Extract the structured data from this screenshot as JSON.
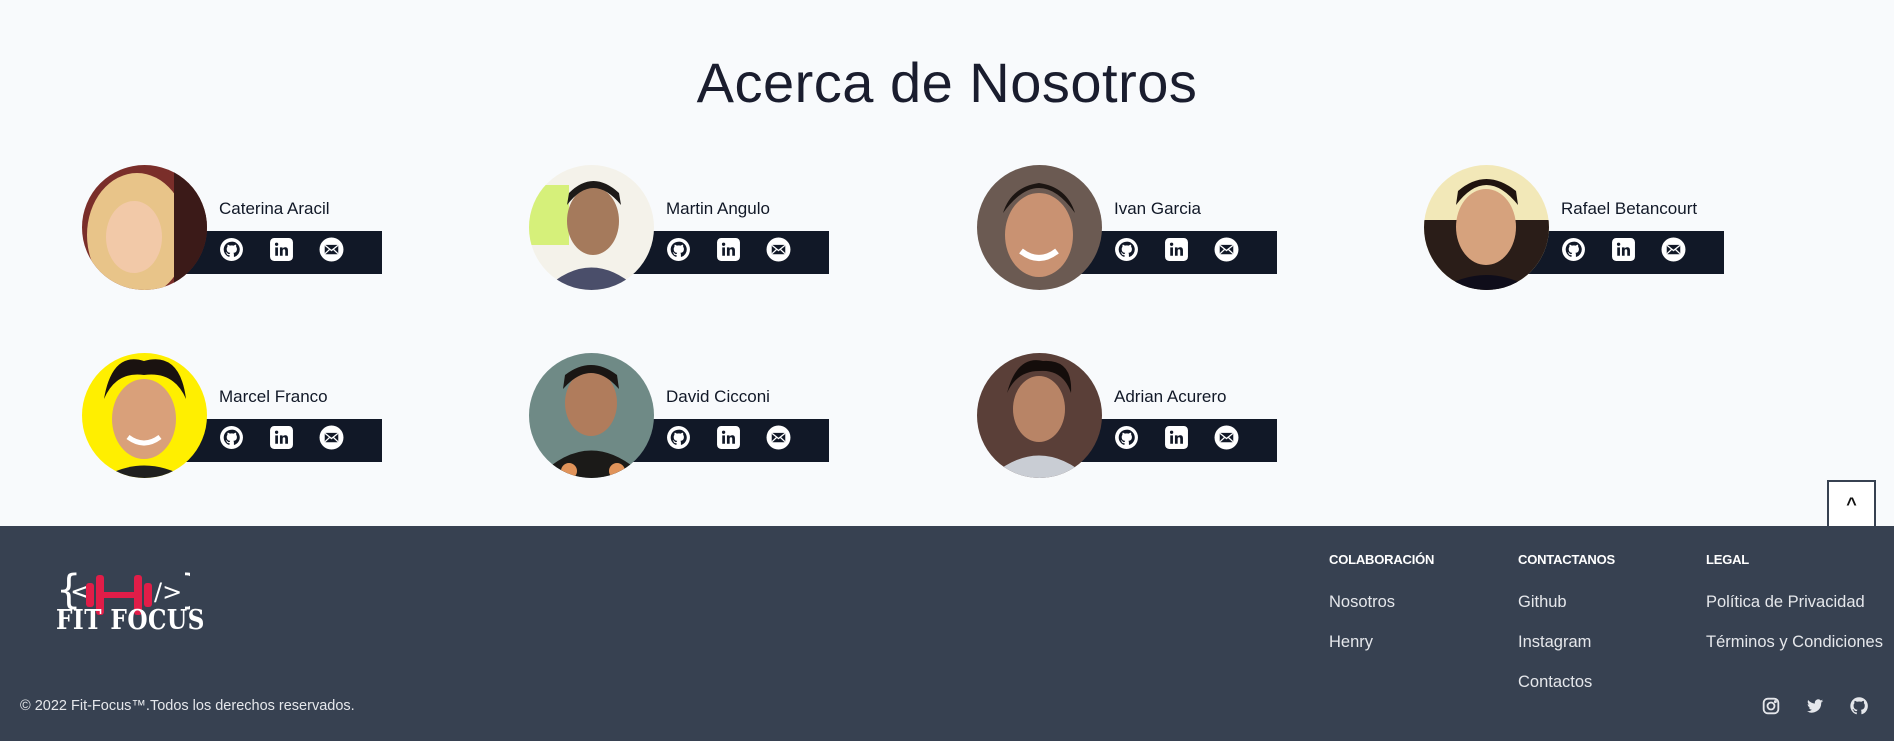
{
  "about": {
    "title": "Acerca de Nosotros",
    "members": [
      {
        "name": "Caterina Aracil"
      },
      {
        "name": "Martin Angulo"
      },
      {
        "name": "Ivan Garcia"
      },
      {
        "name": "Rafael Betancourt"
      },
      {
        "name": "Marcel Franco"
      },
      {
        "name": "David Cicconi"
      },
      {
        "name": "Adrian Acurero"
      }
    ],
    "member_icons": [
      "github-icon",
      "linkedin-icon",
      "mail-icon"
    ]
  },
  "scroll_top": {
    "label": "^"
  },
  "footer": {
    "logo_text": "FIT FOCUS",
    "columns": [
      {
        "heading": "COLABORACIÓN",
        "links": [
          "Nosotros",
          "Henry"
        ]
      },
      {
        "heading": "CONTACTANOS",
        "links": [
          "Github",
          "Instagram",
          "Contactos"
        ]
      },
      {
        "heading": "LEGAL",
        "links": [
          "Política de Privacidad",
          "Términos y Condiciones"
        ]
      }
    ],
    "copyright": "© 2022 Fit-Focus™.Todos los derechos reservados.",
    "social_icons": [
      "instagram-icon",
      "twitter-icon",
      "github-icon"
    ]
  },
  "colors": {
    "page_bg": "#f8fafc",
    "card_bar": "#111827",
    "footer_bg": "#374151",
    "logo_accent": "#e11d48"
  }
}
